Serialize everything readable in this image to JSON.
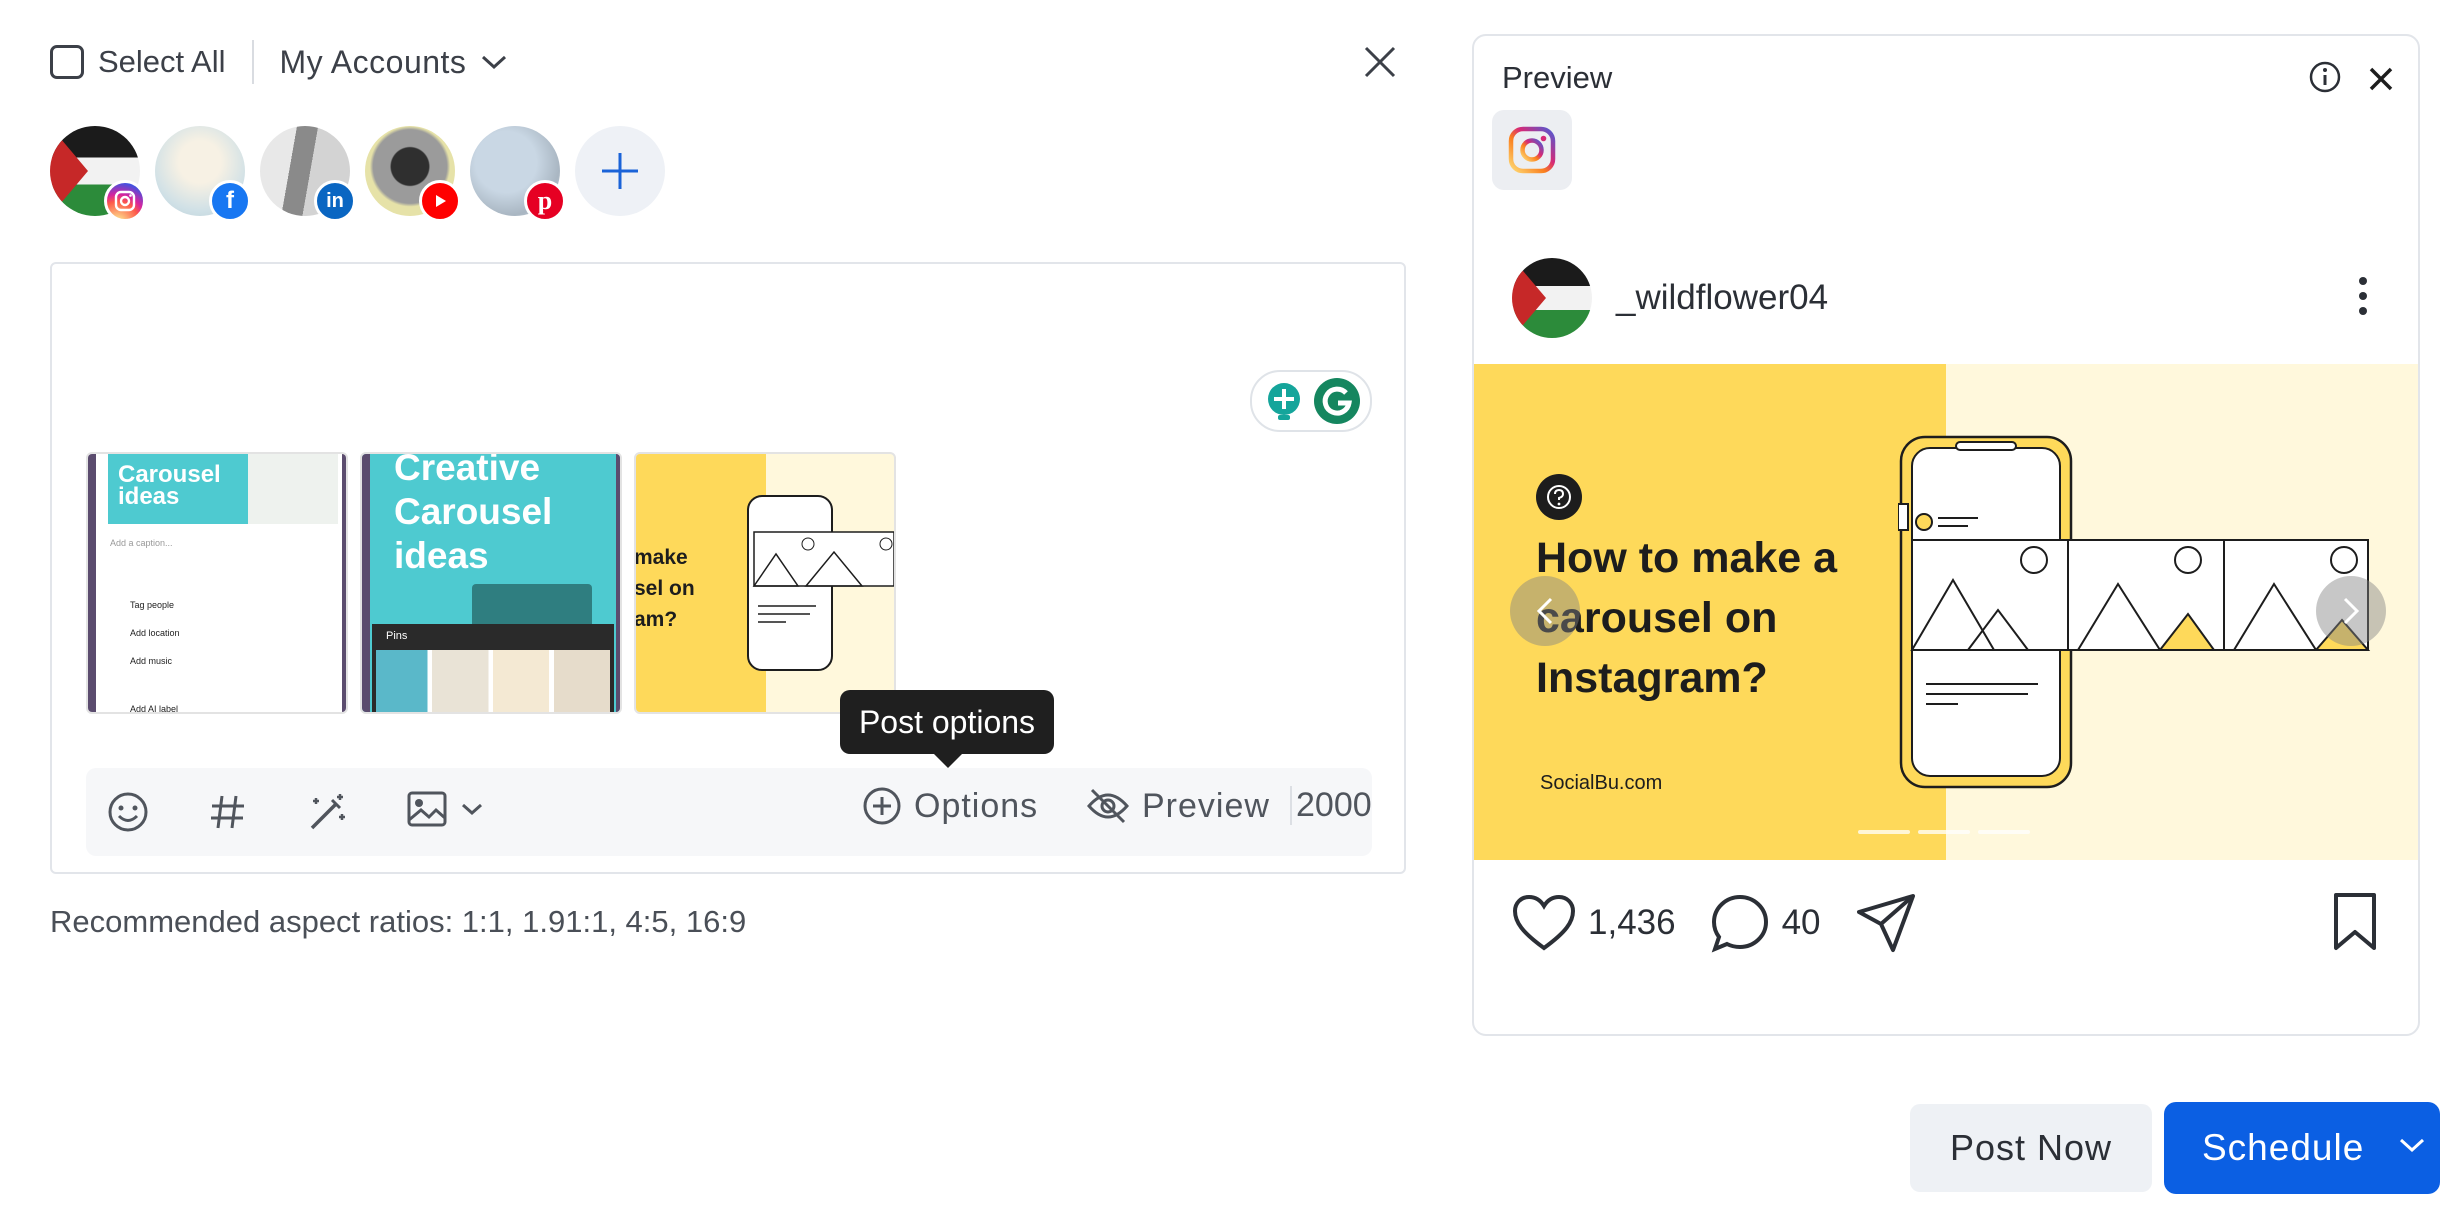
{
  "header": {
    "select_all_label": "Select All",
    "accounts_dropdown_label": "My Accounts"
  },
  "accounts": [
    {
      "network": "instagram",
      "badge_color": "#d6249f"
    },
    {
      "network": "facebook",
      "badge_color": "#1877f2"
    },
    {
      "network": "linkedin",
      "badge_color": "#0a66c2"
    },
    {
      "network": "youtube",
      "badge_color": "#ff0000"
    },
    {
      "network": "pinterest",
      "badge_color": "#e60023"
    }
  ],
  "editor": {
    "media": [
      {
        "title": "Carousel ideas",
        "caption_placeholder": "Add a caption...",
        "items": [
          "Tag people",
          "Add location",
          "Add music",
          "Add AI label"
        ]
      },
      {
        "title": "Creative Carousel ideas",
        "tab": "Pins"
      },
      {
        "title": "make sel on am?"
      }
    ],
    "tooltip": "Post options",
    "toolbar": {
      "options_label": "Options",
      "preview_label": "Preview",
      "char_count": "2000"
    }
  },
  "aspect_hint": "Recommended aspect ratios: 1:1, 1.91:1, 4:5, 16:9",
  "preview": {
    "title": "Preview",
    "active_network": "instagram",
    "username": "_wildflower04",
    "slide": {
      "heading": "How to make a carousel on Instagram?",
      "source": "SocialBu.com",
      "bg_left": "#fed95a",
      "bg_right": "#fff8dc"
    },
    "likes": "1,436",
    "comments": "40"
  },
  "actions": {
    "post_now_label": "Post Now",
    "schedule_label": "Schedule",
    "schedule_color": "#0b5fe3"
  }
}
